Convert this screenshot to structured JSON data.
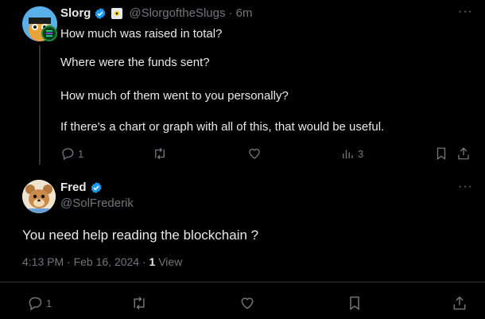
{
  "parent_tweet": {
    "author_name": "Slorg",
    "handle": "@SlorgoftheSlugs",
    "time": "· 6m",
    "lines": [
      "How much was raised in total?",
      "Where were the funds sent?",
      "How much of them went to you personally?",
      "If there's a chart or graph with all of this, that would be useful."
    ],
    "reply_count": "1",
    "views_count": "3"
  },
  "main_tweet": {
    "author_name": "Fred",
    "handle": "@SolFrederik",
    "text": "You need help reading the blockchain ?",
    "timestamp": "4:13 PM · Feb 16, 2024 · ",
    "views_number": "1",
    "views_label": "View",
    "reply_count": "1"
  },
  "colors": {
    "background": "#000000",
    "text": "#e7e9ea",
    "muted": "#71767b",
    "verified": "#1d9bf0",
    "divider": "#2f3336"
  }
}
